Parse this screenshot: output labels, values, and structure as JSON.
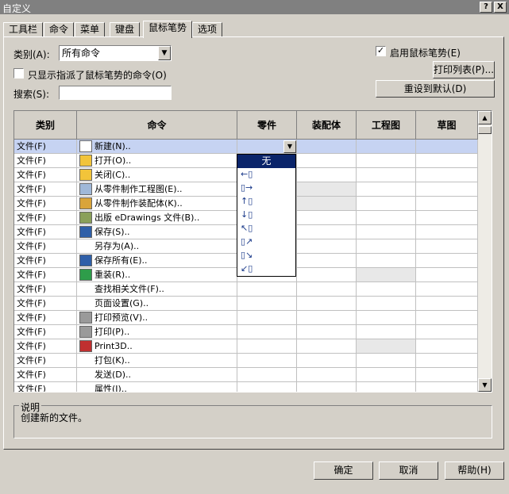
{
  "window": {
    "title": "自定义",
    "help_btn": "?",
    "close_btn": "X"
  },
  "tabs": [
    {
      "label": "工具栏"
    },
    {
      "label": "命令"
    },
    {
      "label": "菜单"
    },
    {
      "label": "键盘"
    },
    {
      "label": "鼠标笔势"
    },
    {
      "label": "选项"
    }
  ],
  "filters": {
    "category_label": "类别(A):",
    "category_value": "所有命令",
    "only_assigned_label": "只显示指派了鼠标笔势的命令(O)",
    "search_label": "搜索(S):",
    "search_value": ""
  },
  "options": {
    "enable_gestures_label": "启用鼠标笔势(E)",
    "enable_gestures_checked": true,
    "print_list_button": "打印列表(P)...",
    "reset_defaults_button": "重设到默认(D)"
  },
  "grid": {
    "columns": [
      "类别",
      "命令",
      "零件",
      "装配体",
      "工程图",
      "草图"
    ],
    "rows": [
      {
        "category": "文件(F)",
        "command": "新建(N)..",
        "icon": "new-doc-icon"
      },
      {
        "category": "文件(F)",
        "command": "打开(O)..",
        "icon": "open-folder-icon"
      },
      {
        "category": "文件(F)",
        "command": "关闭(C)..",
        "icon": "close-folder-icon"
      },
      {
        "category": "文件(F)",
        "command": "从零件制作工程图(E)..",
        "icon": "make-drawing-icon"
      },
      {
        "category": "文件(F)",
        "command": "从零件制作装配体(K)..",
        "icon": "make-assembly-icon"
      },
      {
        "category": "文件(F)",
        "command": "出版 eDrawings 文件(B)..",
        "icon": "edrawings-icon"
      },
      {
        "category": "文件(F)",
        "command": "保存(S)..",
        "icon": "save-icon"
      },
      {
        "category": "文件(F)",
        "command": "另存为(A)..",
        "icon": ""
      },
      {
        "category": "文件(F)",
        "command": "保存所有(E)..",
        "icon": "save-all-icon"
      },
      {
        "category": "文件(F)",
        "command": "重装(R)..",
        "icon": "reload-icon"
      },
      {
        "category": "文件(F)",
        "command": "查找相关文件(F)..",
        "icon": ""
      },
      {
        "category": "文件(F)",
        "command": "页面设置(G)..",
        "icon": ""
      },
      {
        "category": "文件(F)",
        "command": "打印预览(V)..",
        "icon": "print-preview-icon"
      },
      {
        "category": "文件(F)",
        "command": "打印(P)..",
        "icon": "print-icon"
      },
      {
        "category": "文件(F)",
        "command": "Print3D..",
        "icon": "print3d-icon"
      },
      {
        "category": "文件(F)",
        "command": "打包(K)..",
        "icon": ""
      },
      {
        "category": "文件(F)",
        "command": "发送(D)..",
        "icon": ""
      },
      {
        "category": "文件(F)",
        "command": "属性(I)..",
        "icon": ""
      }
    ]
  },
  "gesture_dropdown": {
    "selected": "无",
    "options": [
      "gesture-left-icon",
      "gesture-right-icon",
      "gesture-up-icon",
      "gesture-down-icon",
      "gesture-upleft-icon",
      "gesture-upright-icon",
      "gesture-downright-icon",
      "gesture-downleft-icon"
    ]
  },
  "description": {
    "legend": "说明",
    "text": "创建新的文件。"
  },
  "footer": {
    "ok": "确定",
    "cancel": "取消",
    "help": "帮助(H)"
  }
}
